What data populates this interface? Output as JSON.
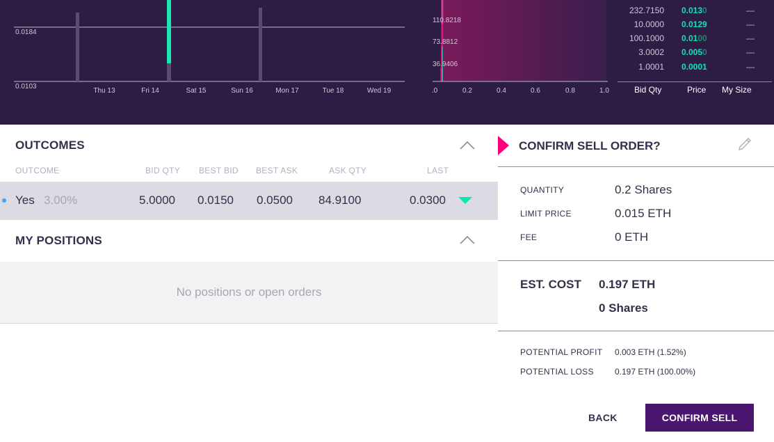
{
  "price_chart": {
    "y_ticks": [
      "0.0184",
      "0.0103"
    ],
    "x_ticks": [
      "Thu 13",
      "Fri 14",
      "Sat 15",
      "Sun 16",
      "Mon 17",
      "Tue 18",
      "Wed 19"
    ]
  },
  "depth_chart": {
    "y_ticks": [
      "110.8218",
      "73.8812",
      "36.9406"
    ],
    "x_ticks": [
      ".0",
      "0.2",
      "0.4",
      "0.6",
      "0.8",
      "1.0"
    ]
  },
  "order_book": {
    "rows": [
      {
        "qty": "232.7150",
        "price_bright": "0.013",
        "price_dim": "0",
        "size": "—"
      },
      {
        "qty": "10.0000",
        "price_bright": "0.0129",
        "price_dim": "",
        "size": "—"
      },
      {
        "qty": "100.1000",
        "price_bright": "0.01",
        "price_dim": "00",
        "size": "—"
      },
      {
        "qty": "3.0002",
        "price_bright": "0.005",
        "price_dim": "0",
        "size": "—"
      },
      {
        "qty": "1.0001",
        "price_bright": "0.0001",
        "price_dim": "",
        "size": "—"
      }
    ],
    "headers": {
      "bid_qty": "Bid Qty",
      "price": "Price",
      "my_size": "My Size"
    }
  },
  "outcomes": {
    "title": "OUTCOMES",
    "columns": {
      "outcome": "OUTCOME",
      "bid_qty": "BID QTY",
      "best_bid": "BEST BID",
      "best_ask": "BEST ASK",
      "ask_qty": "ASK QTY",
      "last": "LAST"
    },
    "row": {
      "name": "Yes",
      "percent": "3.00%",
      "bid_qty": "5.0000",
      "best_bid": "0.0150",
      "best_ask": "0.0500",
      "ask_qty": "84.9100",
      "last": "0.0300"
    }
  },
  "positions": {
    "title": "MY POSITIONS",
    "empty_text": "No positions or open orders"
  },
  "confirm": {
    "title": "CONFIRM SELL ORDER?",
    "quantity_label": "QUANTITY",
    "quantity_value": "0.2 Shares",
    "limit_price_label": "LIMIT PRICE",
    "limit_price_value": "0.015 ETH",
    "fee_label": "FEE",
    "fee_value": "0 ETH",
    "est_cost_label": "EST. COST",
    "est_cost_value": "0.197 ETH",
    "est_cost_shares": "0 Shares",
    "profit_label": "POTENTIAL PROFIT",
    "profit_value": "0.003 ETH (1.52%)",
    "loss_label": "POTENTIAL LOSS",
    "loss_value": "0.197 ETH (100.00%)",
    "back_label": "BACK",
    "confirm_label": "CONFIRM SELL"
  },
  "colors": {
    "header_bg": "#2d1c44",
    "accent_green": "#09e8b4",
    "accent_pink": "#ff007a",
    "button_purple": "#4a1670"
  }
}
